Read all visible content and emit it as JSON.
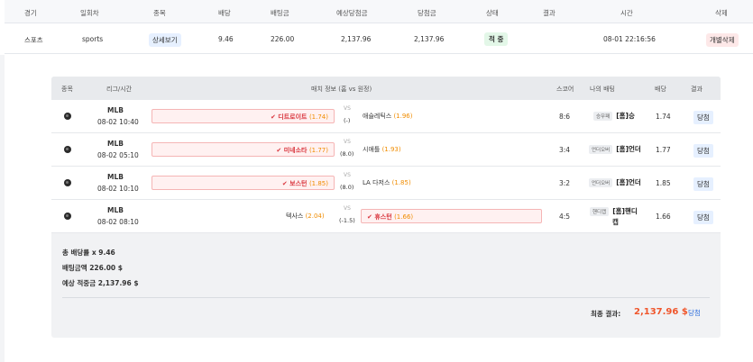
{
  "header": {
    "columns": [
      "경기",
      "일회차",
      "종목",
      "배당",
      "배팅금",
      "예상당첨금",
      "당첨금",
      "상태",
      "결과",
      "시간",
      "삭제"
    ]
  },
  "bet_row": {
    "sport": "스포츠",
    "round": "sports",
    "detail_button": "상세보기",
    "odds": "9.46",
    "bet_amount": "226.00",
    "expected_win": "2,137.96",
    "win_amount": "2,137.96",
    "status": "적 중",
    "result": "",
    "time": "08-01 22:16:56",
    "delete_button": "개별삭제"
  },
  "detail": {
    "columns": [
      "종목",
      "리그/시간",
      "매치 정보 (홈 vs 원정)",
      "스코어",
      "나의 배팅",
      "배당",
      "결과"
    ],
    "matches": [
      {
        "league": "MLB",
        "time": "08-02 10:40",
        "home": "디트로이트",
        "home_odds": "(1.74)",
        "vs": "VS",
        "handicap": "(-)",
        "away": "애슬레틱스",
        "away_odds": "(1.96)",
        "picked": "home",
        "score": "8:6",
        "bet_tag": "승무패",
        "bet_pick": "[홈]승",
        "odds": "1.74",
        "result": "당첨"
      },
      {
        "league": "MLB",
        "time": "08-02 05:10",
        "home": "미네소타",
        "home_odds": "(1.77)",
        "vs": "VS",
        "handicap": "(8.0)",
        "away": "시애틀",
        "away_odds": "(1.93)",
        "picked": "home",
        "score": "3:4",
        "bet_tag": "언더오버",
        "bet_pick": "[홈]언더",
        "odds": "1.77",
        "result": "당첨"
      },
      {
        "league": "MLB",
        "time": "08-02 10:10",
        "home": "보스턴",
        "home_odds": "(1.85)",
        "vs": "VS",
        "handicap": "(8.0)",
        "away": "LA 다저스",
        "away_odds": "(1.85)",
        "picked": "home",
        "score": "3:2",
        "bet_tag": "언더오버",
        "bet_pick": "[홈]언더",
        "odds": "1.85",
        "result": "당첨"
      },
      {
        "league": "MLB",
        "time": "08-02 08:10",
        "home": "텍사스",
        "home_odds": "(2.04)",
        "vs": "VS",
        "handicap": "(-1.5)",
        "away": "휴스턴",
        "away_odds": "(1.66)",
        "picked": "away",
        "score": "4:5",
        "bet_tag": "핸디캡",
        "bet_pick_line1": "[홈]핸디",
        "bet_pick_line2": "캡",
        "odds": "1.66",
        "result": "당첨"
      }
    ],
    "summary": {
      "total_odds": "총 배당률 x 9.46",
      "bet_amount": "배팅금액 226.00 $",
      "expected": "예상 적중금 2,137.96 $"
    },
    "final": {
      "label": "최종 결과:",
      "value": "2,137.96 $",
      "result": "당첨"
    }
  }
}
